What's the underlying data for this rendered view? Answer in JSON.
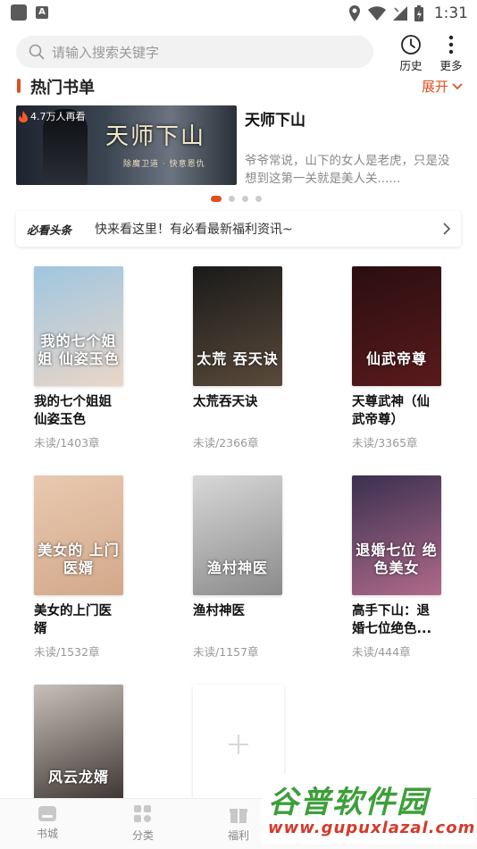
{
  "status_bar": {
    "time": "1:31",
    "app_badge": "A"
  },
  "search": {
    "placeholder": "请输入搜索关键字"
  },
  "header_actions": {
    "history_label": "历史",
    "more_label": "更多"
  },
  "section": {
    "title": "热门书单",
    "expand_label": "展开"
  },
  "banner": {
    "views_badge": "4.7万人再看",
    "cover_title": "天师下山",
    "cover_subtitle": "除魔卫道 · 快意恩仇",
    "book_title": "天师下山",
    "description": "爷爷常说，山下的女人是老虎，只是没想到这第一关就是美人关......",
    "dot_count": 4,
    "active_dot": 0
  },
  "news": {
    "logo": "必看头条",
    "text": "快来看这里！有必看最新福利资讯~"
  },
  "books": [
    {
      "title": "我的七个姐姐仙姿玉色",
      "meta": "未读/1403章",
      "cover_text": "我的七个姐姐 仙姿玉色",
      "colors": [
        "#9fc6e0",
        "#e9d6c8"
      ]
    },
    {
      "title": "太荒吞天诀",
      "meta": "未读/2366章",
      "cover_text": "太荒 吞天诀",
      "colors": [
        "#1a1a1a",
        "#5a4a3a"
      ]
    },
    {
      "title": "天尊武神（仙武帝尊）",
      "meta": "未读/3365章",
      "cover_text": "仙武帝尊",
      "colors": [
        "#2a0e10",
        "#5a1a1c"
      ]
    },
    {
      "title": "美女的上门医婿",
      "meta": "未读/1532章",
      "cover_text": "美女的 上门医婿",
      "colors": [
        "#e8c9b0",
        "#d3a88a"
      ]
    },
    {
      "title": "渔村神医",
      "meta": "未读/1157章",
      "cover_text": "渔村神医",
      "colors": [
        "#d8d8d8",
        "#8a8a8a"
      ]
    },
    {
      "title": "高手下山：退婚七位绝色...",
      "meta": "未读/444章",
      "cover_text": "退婚七位 绝色美女",
      "colors": [
        "#3a3050",
        "#b06a8a"
      ]
    },
    {
      "title": "风云龙婿",
      "meta": "",
      "cover_text": "风云龙婿",
      "colors": [
        "#c8c0b8",
        "#3a3230"
      ]
    }
  ],
  "tabs": [
    {
      "label": "书城"
    },
    {
      "label": "分类"
    },
    {
      "label": "福利"
    }
  ],
  "watermark": {
    "big": "谷普软件园",
    "small": "www.gupuxlazal.com"
  }
}
